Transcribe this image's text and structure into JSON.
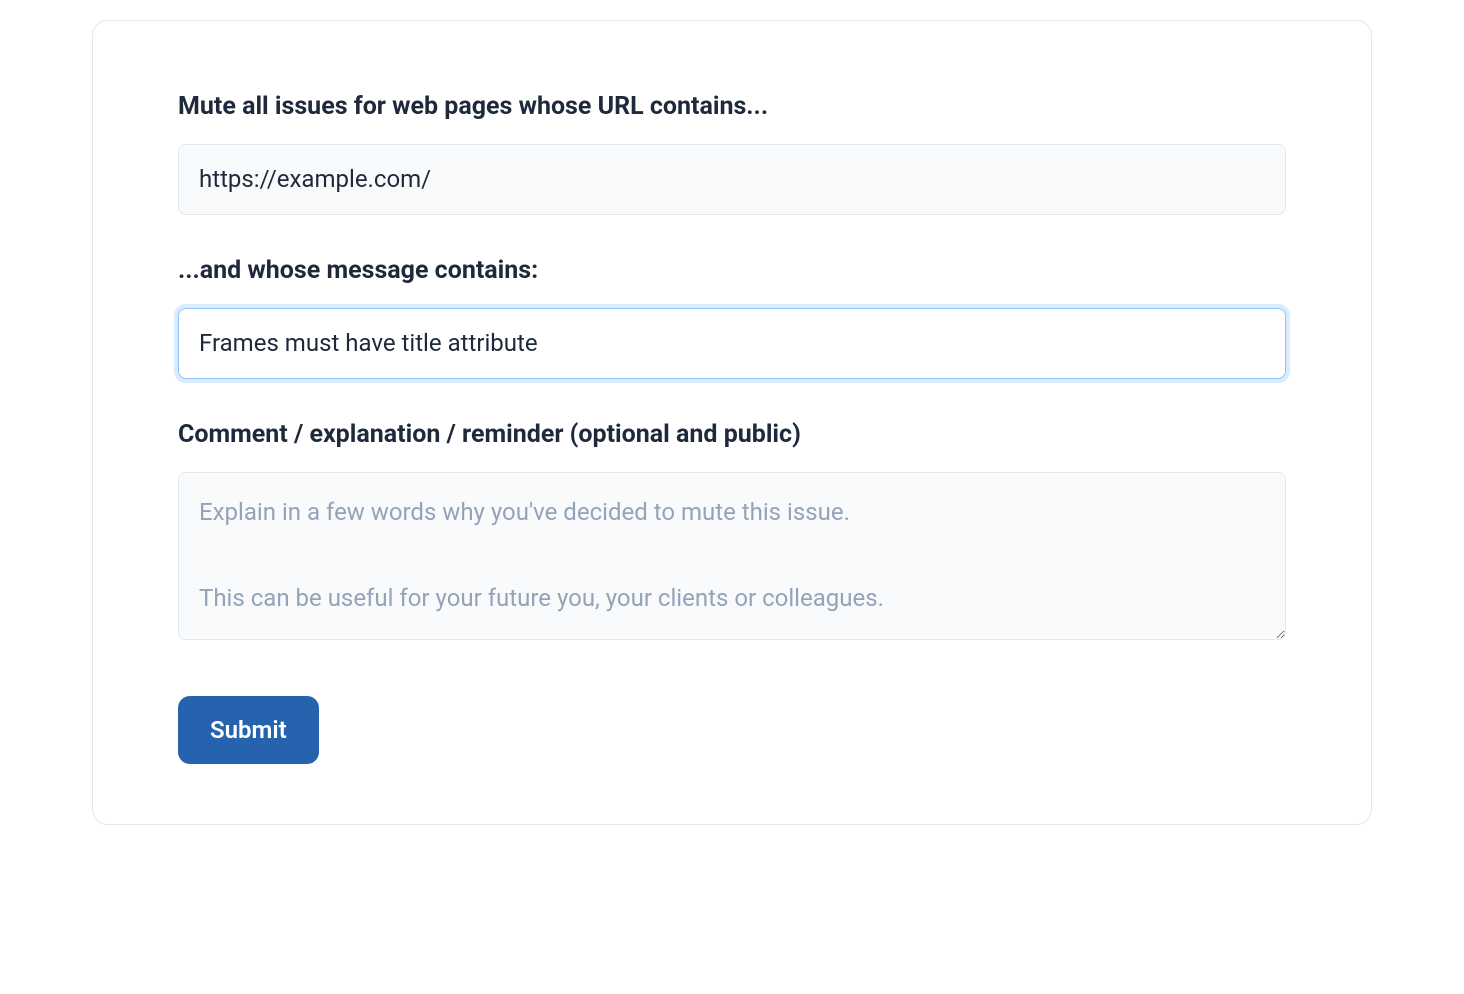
{
  "form": {
    "url_field": {
      "label": "Mute all issues for web pages whose URL contains...",
      "value": "https://example.com/"
    },
    "message_field": {
      "label": "...and whose message contains:",
      "value": "Frames must have title attribute"
    },
    "comment_field": {
      "label": "Comment / explanation / reminder (optional and public)",
      "placeholder": "Explain in a few words why you've decided to mute this issue.\n\nThis can be useful for your future you, your clients or colleagues.",
      "value": ""
    },
    "submit_label": "Submit"
  }
}
